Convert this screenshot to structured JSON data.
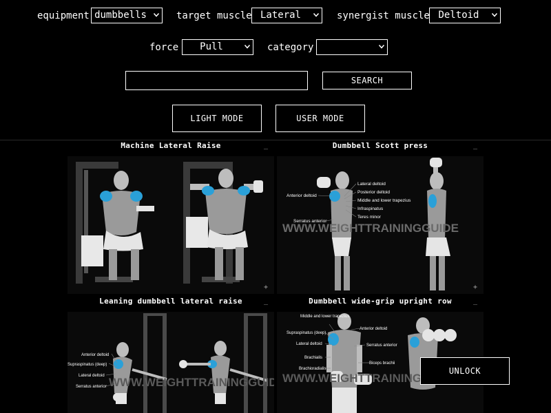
{
  "filters": {
    "equipment": {
      "label": "equipment",
      "value": "dumbbells"
    },
    "target_muscle": {
      "label": "target muscle",
      "value": "Lateral"
    },
    "synergist_muscle": {
      "label": "synergist muscle",
      "value": "Deltoid"
    },
    "force": {
      "label": "force",
      "value": "Pull"
    },
    "category": {
      "label": "category",
      "value": ""
    }
  },
  "search": {
    "placeholder": "",
    "button_label": "SEARCH"
  },
  "modes": {
    "light_label": "LIGHT MODE",
    "user_label": "USER MODE"
  },
  "cards": [
    {
      "title": "Machine Lateral Raise",
      "minimize": "_",
      "expand": "+"
    },
    {
      "title": "Dumbbell Scott press",
      "minimize": "_",
      "expand": "+"
    },
    {
      "title": "Leaning dumbbell lateral raise",
      "minimize": "_",
      "expand": "+"
    },
    {
      "title": "Dumbbell wide-grip upright row",
      "minimize": "_",
      "expand": "+"
    }
  ],
  "image_labels": {
    "scott": [
      "Lateral deltoid",
      "Posterior deltoid",
      "Middle and lower trapezius",
      "Infraspinatus",
      "Teres minor",
      "Anterior deltoid",
      "Serratus anterior"
    ],
    "leaning": [
      "Anterior deltoid",
      "Supraspinatus (deep)",
      "Lateral deltoid",
      "Serratus anterior"
    ],
    "upright": [
      "Middle and lower trapezius",
      "Anterior deltoid",
      "Supraspinatus (deep)",
      "Lateral deltoid",
      "Serratus anterior",
      "Brachialis",
      "Biceps brachii",
      "Brachioradialis"
    ],
    "watermark": "WWW.WEIGHTTRAININGGUIDE"
  },
  "unlock": {
    "label": "UNLOCK"
  },
  "colors": {
    "background": "#000000",
    "border": "#ffffff",
    "muscle_highlight": "#2aa0d8"
  }
}
